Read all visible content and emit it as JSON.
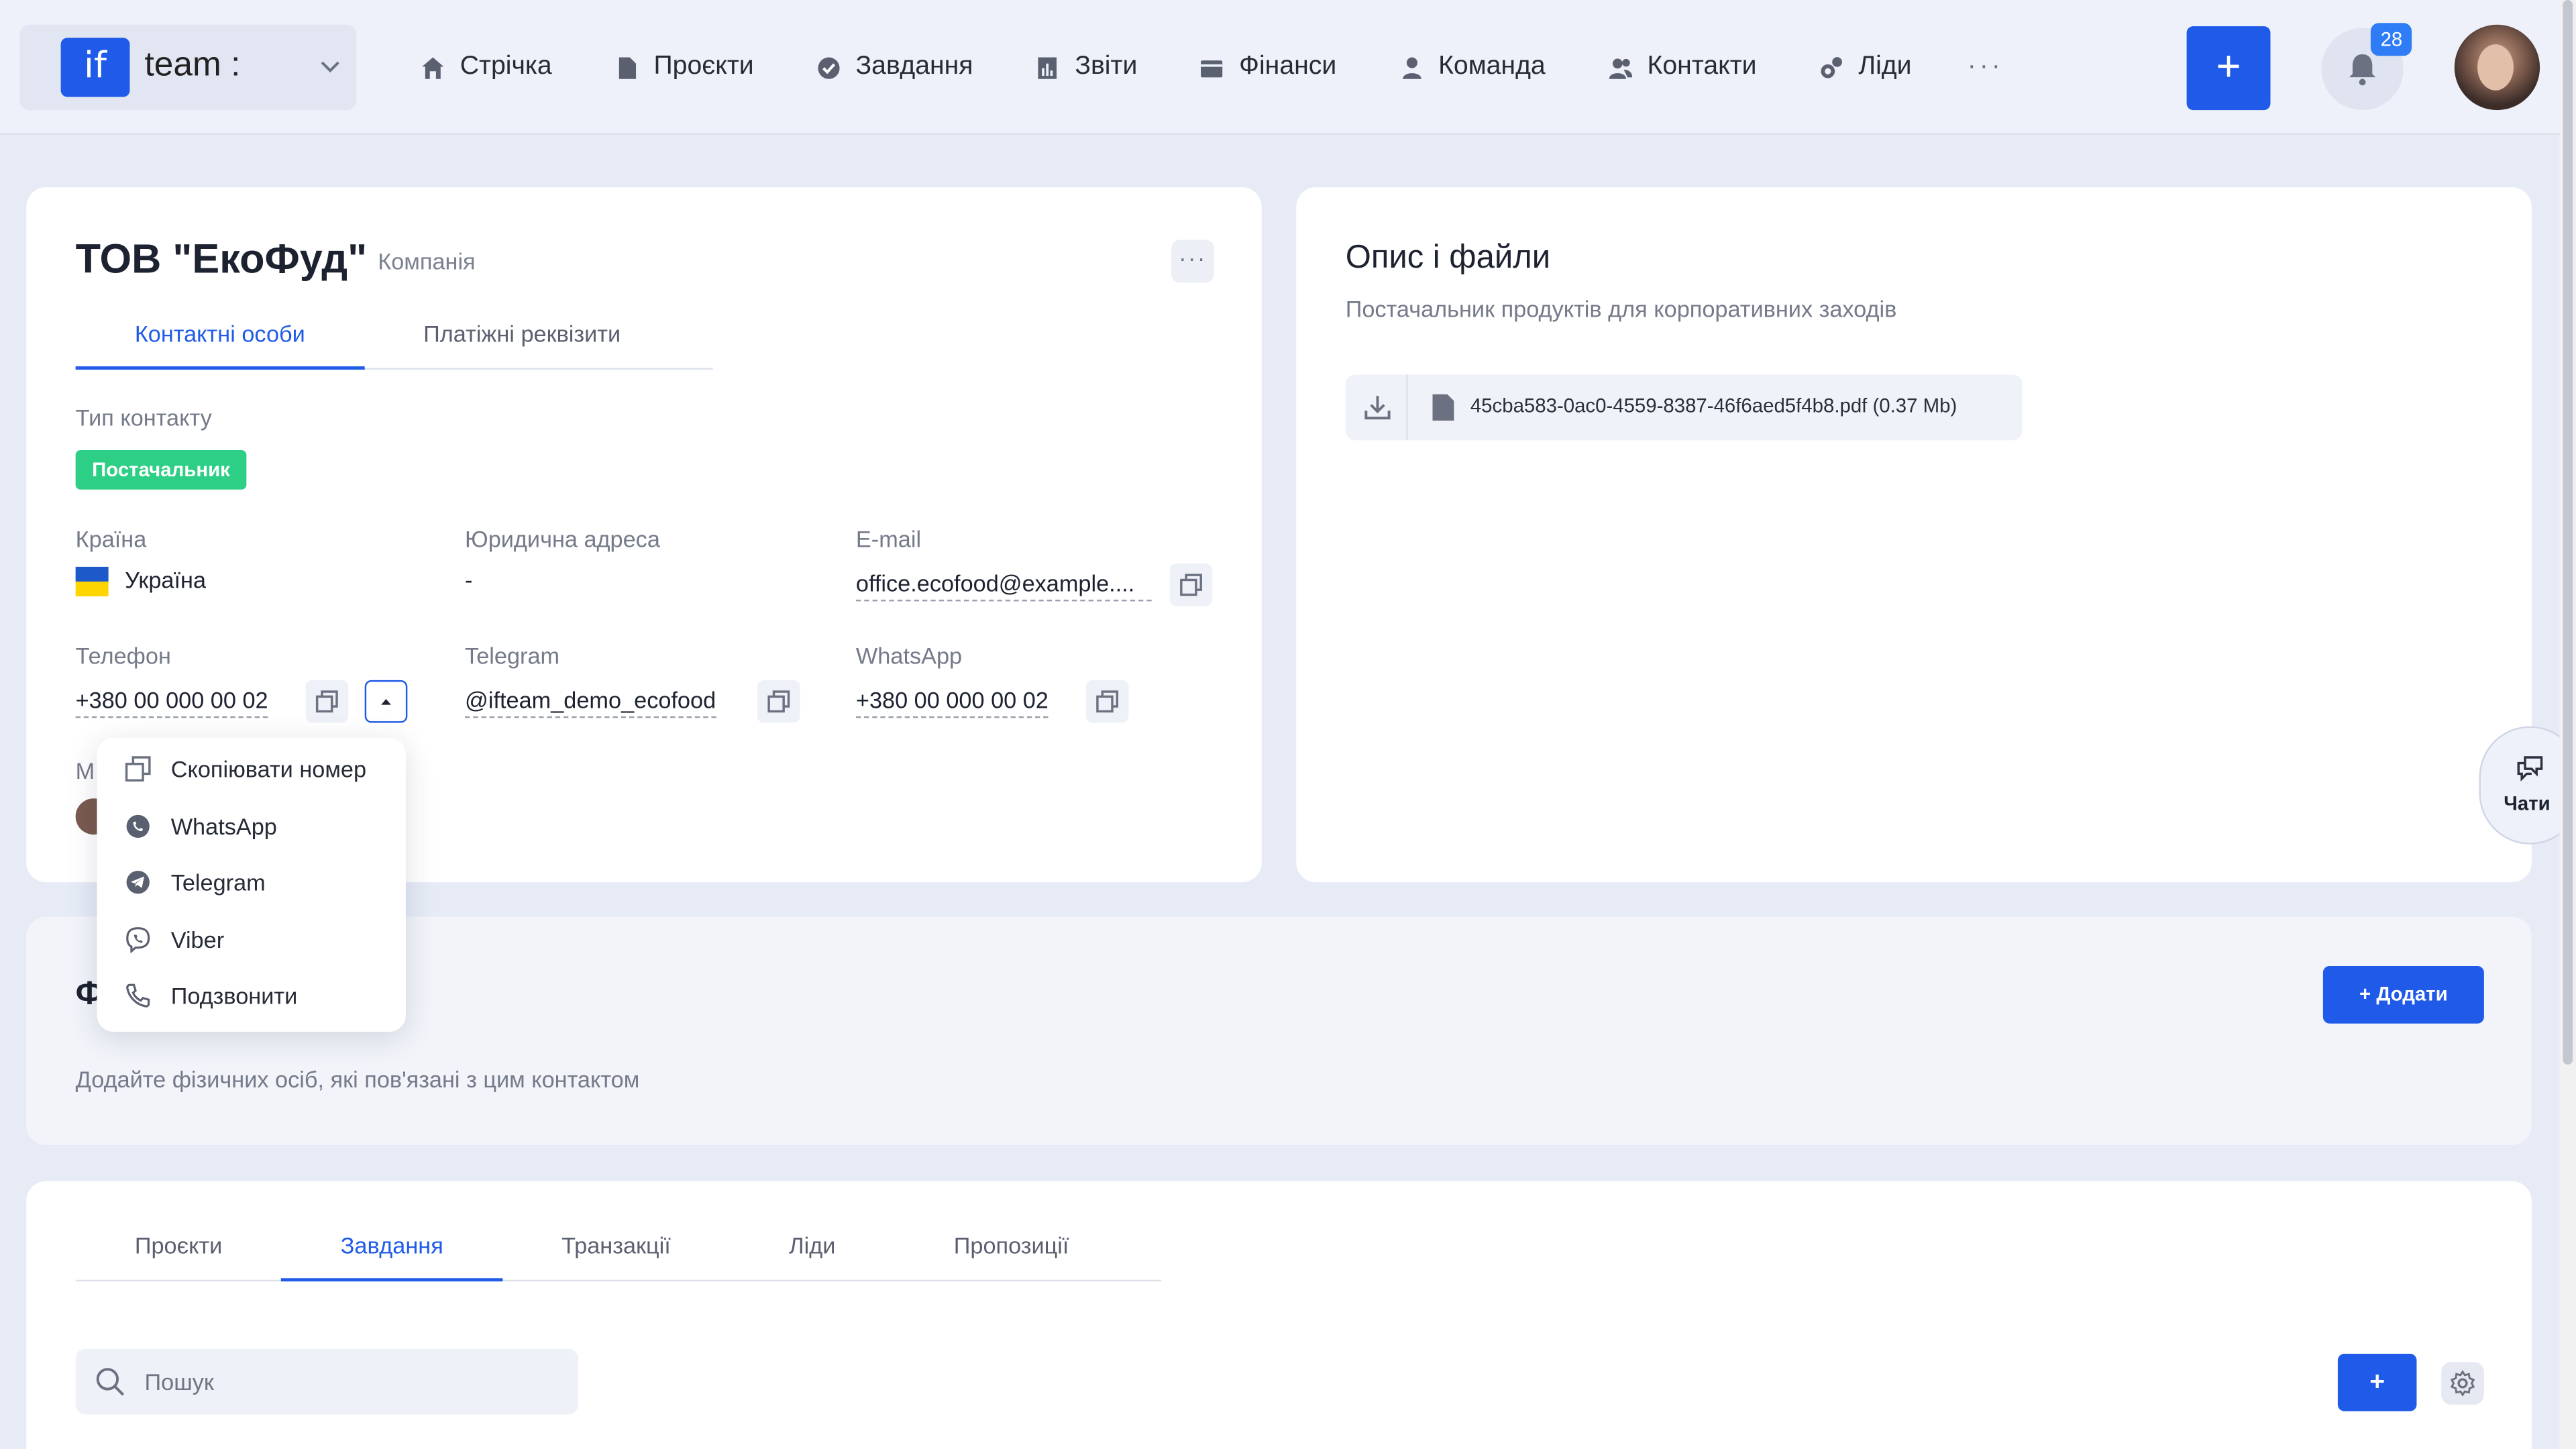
{
  "header": {
    "team_logo": "if",
    "team_name": "team :",
    "nav": [
      {
        "label": "Стрічка",
        "icon": "home-icon"
      },
      {
        "label": "Проєкти",
        "icon": "document-icon"
      },
      {
        "label": "Завдання",
        "icon": "check-circle-icon"
      },
      {
        "label": "Звіти",
        "icon": "report-icon"
      },
      {
        "label": "Фінанси",
        "icon": "wallet-icon"
      },
      {
        "label": "Команда",
        "icon": "person-icon"
      },
      {
        "label": "Контакти",
        "icon": "contacts-icon"
      },
      {
        "label": "Ліди",
        "icon": "leads-icon"
      }
    ],
    "more": "···",
    "add_label": "+",
    "notifications_count": "28"
  },
  "contact": {
    "title": "ТОВ \"ЕкоФуд\"",
    "type": "Компанія",
    "more": "···",
    "tabs": [
      {
        "label": "Контактні особи",
        "active": true
      },
      {
        "label": "Платіжні реквізити",
        "active": false
      }
    ],
    "contact_type_label": "Тип контакту",
    "contact_type_tag": "Постачальник",
    "country_label": "Країна",
    "country_value": "Україна",
    "address_label": "Юридична адреса",
    "address_value": "-",
    "email_label": "E-mail",
    "email_value": "office.ecofood@example....",
    "phone_label": "Телефон",
    "phone_value": "+380 00 000 00 02",
    "telegram_label": "Telegram",
    "telegram_value": "@ifteam_demo_ecofood",
    "whatsapp_label": "WhatsApp",
    "whatsapp_value": "+380 00 000 00 02",
    "partial_label": "М"
  },
  "phone_menu": [
    {
      "label": "Скопіювати номер",
      "icon": "copy-icon"
    },
    {
      "label": "WhatsApp",
      "icon": "whatsapp-icon"
    },
    {
      "label": "Telegram",
      "icon": "telegram-icon"
    },
    {
      "label": "Viber",
      "icon": "viber-icon"
    },
    {
      "label": "Подзвонити",
      "icon": "phone-icon"
    }
  ],
  "description": {
    "title": "Опис і файли",
    "text": "Постачальник продуктів для корпоративних заходів",
    "file_name": "45cba583-0ac0-4559-8387-46f6aed5f4b8.pdf (0.37 Mb)"
  },
  "chat": {
    "label": "Чати"
  },
  "persons": {
    "title": "Ф",
    "hint": "Додайте фізичних осіб, які пов'язані з цим контактом",
    "add_label": "+ Додати"
  },
  "bottom": {
    "tabs": [
      {
        "label": "Проєкти",
        "active": false
      },
      {
        "label": "Завдання",
        "active": true
      },
      {
        "label": "Транзакції",
        "active": false
      },
      {
        "label": "Ліди",
        "active": false
      },
      {
        "label": "Пропозиції",
        "active": false
      }
    ],
    "search_placeholder": "Пошук",
    "add_label": "+"
  },
  "colors": {
    "accent": "#1f5be8",
    "tag_green": "#2ccf85",
    "background": "#e6ebf6"
  }
}
